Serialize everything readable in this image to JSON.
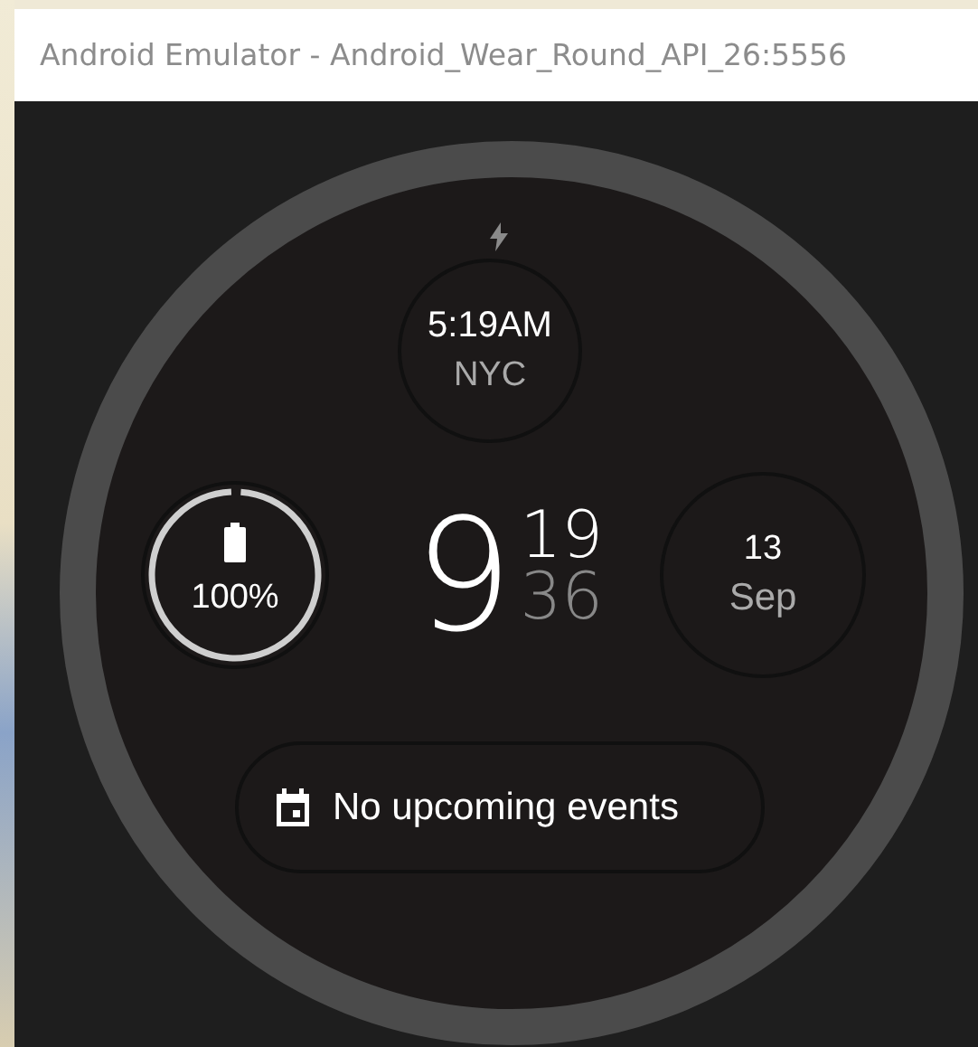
{
  "window": {
    "title": "Android Emulator - Android_Wear_Round_API_26:5556"
  },
  "watch": {
    "charging": true,
    "world_clock": {
      "time": "5:19AM",
      "city": "NYC"
    },
    "battery": {
      "level": 1,
      "reading": "100%"
    },
    "time": {
      "hour": "9",
      "minute": "19",
      "second": "36"
    },
    "date": {
      "day": "13",
      "month": "Sep"
    },
    "events": {
      "text": "No upcoming events"
    }
  }
}
